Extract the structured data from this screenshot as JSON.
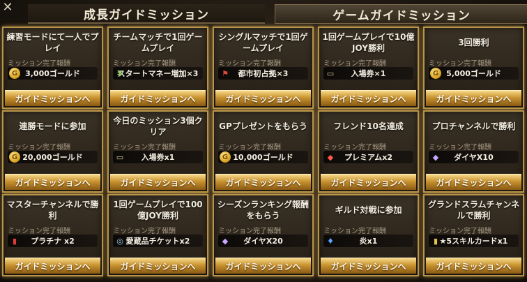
{
  "tabs": {
    "left": "成長ガイドミッション",
    "right": "ゲームガイドミッション"
  },
  "common": {
    "reward_header": "ミッション完了報酬",
    "button_label": "ガイドミッションへ"
  },
  "cards": [
    {
      "title": "練習モードにて一人でプレイ",
      "reward": "3,000ゴールド",
      "icon": "gold-coin-icon"
    },
    {
      "title": "チームマッチで1回ゲームプレイ",
      "reward": "スタートマネー増加×3",
      "icon": "money-icon"
    },
    {
      "title": "シングルマッチで1回ゲームプレイ",
      "reward": "都市初占拠×3",
      "icon": "city-flag-icon"
    },
    {
      "title": "1回ゲームプレイで10億JOY勝利",
      "reward": "入場券×1",
      "icon": "ticket-icon"
    },
    {
      "title": "3回勝利",
      "reward": "5,000ゴールド",
      "icon": "gold-coin-icon"
    },
    {
      "title": "連勝モードに参加",
      "reward": "20,000ゴールド",
      "icon": "gold-coin-icon"
    },
    {
      "title": "今日のミッション3個クリア",
      "reward": "入場券x1",
      "icon": "ticket-icon"
    },
    {
      "title": "GPプレゼントをもらう",
      "reward": "10,000ゴールド",
      "icon": "gold-coin-icon"
    },
    {
      "title": "フレンド10名達成",
      "reward": "プレミアムx2",
      "icon": "premium-dice-icon"
    },
    {
      "title": "プロチャンネルで勝利",
      "reward": "ダイヤX10",
      "icon": "diamond-icon"
    },
    {
      "title": "マスターチャンネルで勝利",
      "reward": "プラチナ x2",
      "icon": "platinum-card-icon"
    },
    {
      "title": "1回ゲームプレイで100億JOY勝利",
      "reward": "愛蔵品チケットx2",
      "icon": "collection-ticket-icon"
    },
    {
      "title": "シーズンランキング報酬をもらう",
      "reward": "ダイヤX20",
      "icon": "diamond-icon"
    },
    {
      "title": "ギルド対戦に参加",
      "reward": "炎x1",
      "icon": "flame-icon"
    },
    {
      "title": "グランドスラムチャンネルで勝利",
      "reward": "★5スキルカードx1",
      "icon": "skill-card-icon"
    }
  ],
  "colors": {
    "border": "#b8944a",
    "button": "#c9932f"
  }
}
